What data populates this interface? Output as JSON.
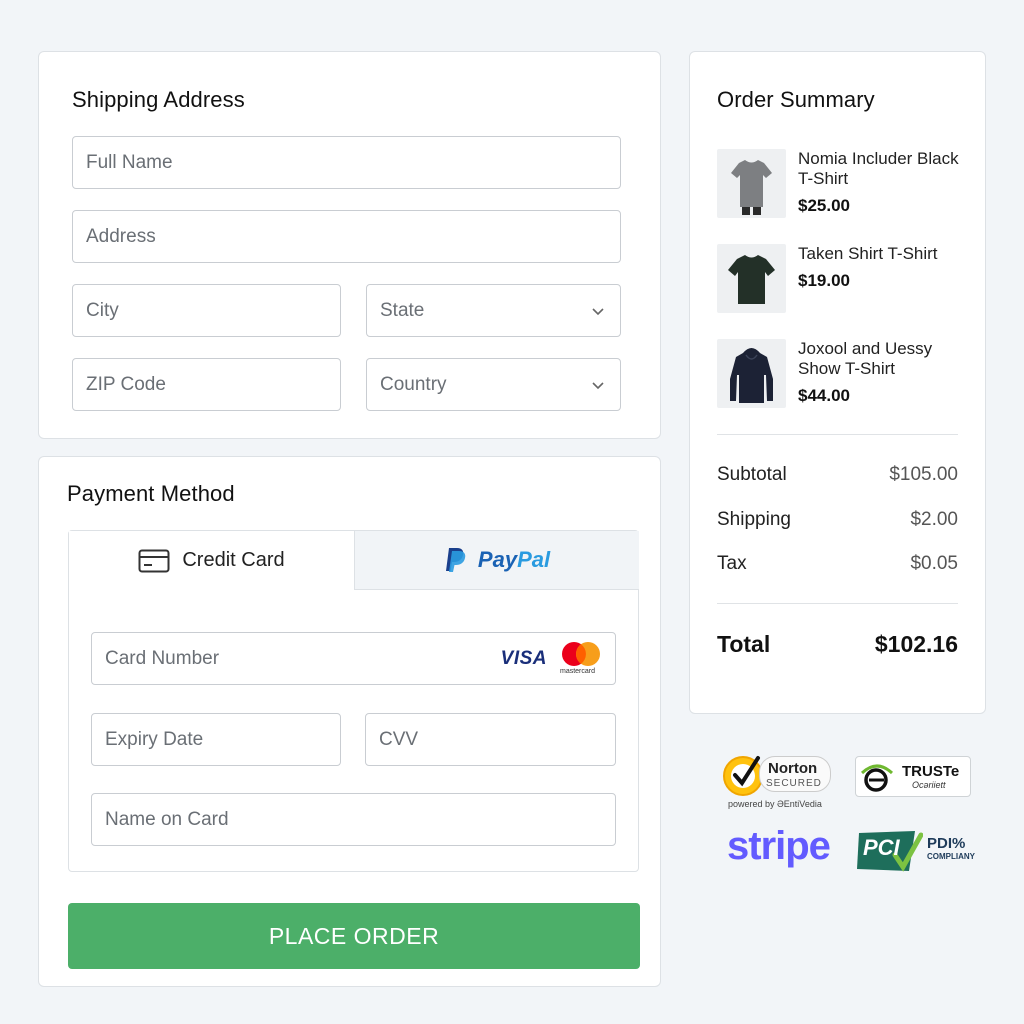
{
  "shipping": {
    "title": "Shipping Address",
    "full_name_placeholder": "Full Name",
    "address_placeholder": "Address",
    "city_placeholder": "City",
    "state_placeholder": "State",
    "zip_placeholder": "ZIP Code",
    "country_placeholder": "Country"
  },
  "payment": {
    "title": "Payment Method",
    "tabs": [
      {
        "label": "Credit Card",
        "icon": "credit-card-icon",
        "selected": true
      },
      {
        "label": "PayPal",
        "icon": "paypal-logo",
        "selected": false
      }
    ],
    "card_number_placeholder": "Card Number",
    "expiry_placeholder": "Expiry Date",
    "cvv_placeholder": "CVV",
    "name_on_card_placeholder": "Name on Card",
    "card_brands": [
      "VISA",
      "mastercard"
    ],
    "place_order_label": "PLACE ORDER",
    "place_order_color": "#4caf69"
  },
  "summary": {
    "title": "Order Summary",
    "items": [
      {
        "name": "Nomia Includer Black T-Shirt",
        "price": "$25.00",
        "image": "gray-tshirt"
      },
      {
        "name": "Taken Shirt T-Shirt",
        "price": "$19.00",
        "image": "dark-green-tshirt"
      },
      {
        "name": "Joxool and Uessy Show T-Shirt",
        "price": "$44.00",
        "image": "navy-hoodie"
      }
    ],
    "subtotal_label": "Subtotal",
    "subtotal_value": "$105.00",
    "shipping_label": "Shipping",
    "shipping_value": "$2.00",
    "tax_label": "Tax",
    "tax_value": "$0.05",
    "total_label": "Total",
    "total_value": "$102.16"
  },
  "badges": {
    "norton_name": "Norton",
    "norton_secured": "SECURED",
    "norton_powered": "powered by ƏEntiVedia",
    "truste_name": "TRUSTe",
    "truste_sub": "Ocəriiett",
    "stripe_name": "stripe",
    "pci_name": "PCI",
    "pci_title": "PDI%",
    "pci_sub": "COMPLIANY"
  }
}
